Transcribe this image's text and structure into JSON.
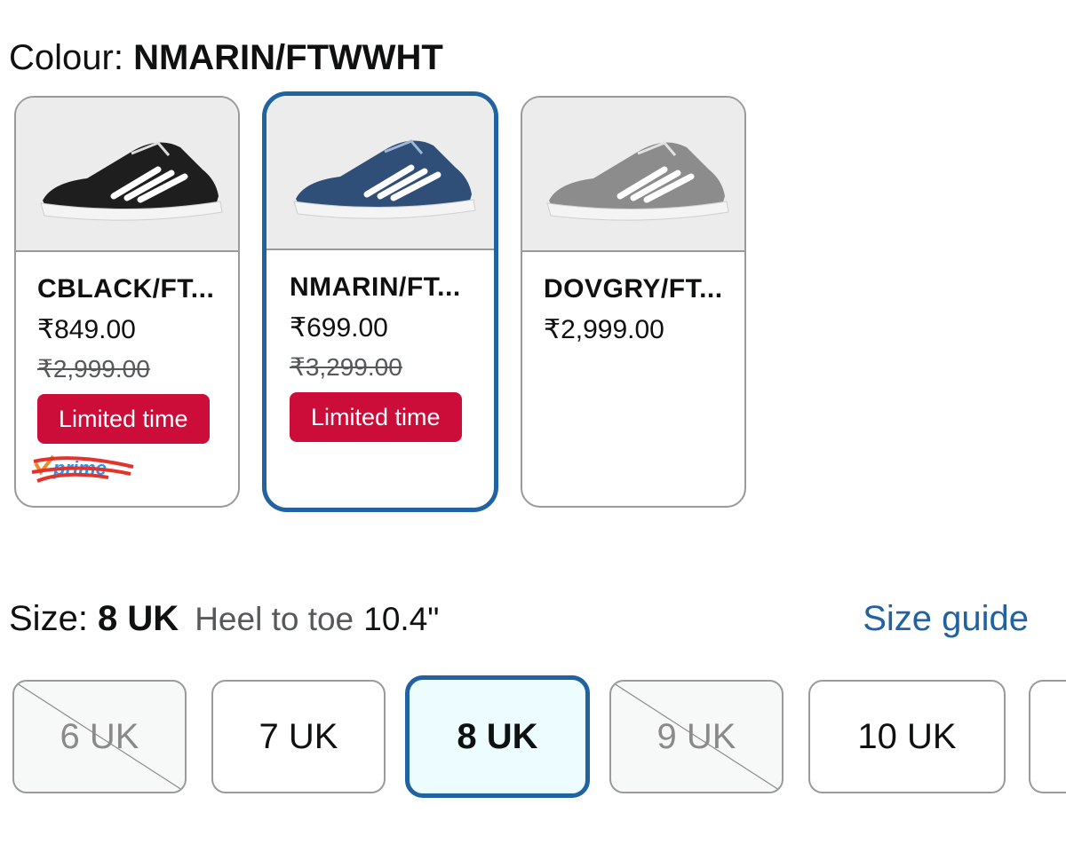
{
  "colour": {
    "label": "Colour: ",
    "selected": "NMARIN/FTWWHT"
  },
  "swatches": [
    {
      "name": "CBLACK/FT...",
      "price": "₹849.00",
      "mrp": "₹2,999.00",
      "badge": "Limited time",
      "prime": "prime",
      "shoe_color": "#1e1e1e",
      "selected": false
    },
    {
      "name": "NMARIN/FT...",
      "price": "₹699.00",
      "mrp": "₹3,299.00",
      "badge": "Limited time",
      "shoe_color": "#2f4f78",
      "selected": true
    },
    {
      "name": "DOVGRY/FT...",
      "price": "₹2,999.00",
      "shoe_color": "#8c8c8c",
      "selected": false
    }
  ],
  "size": {
    "label": "Size: ",
    "selected": "8 UK",
    "heel_label": "Heel to toe",
    "heel_value": "10.4\"",
    "guide_link": "Size guide"
  },
  "sizes": [
    {
      "label": "6 UK",
      "available": false
    },
    {
      "label": "7 UK",
      "available": true
    },
    {
      "label": "8 UK",
      "available": true,
      "selected": true
    },
    {
      "label": "9 UK",
      "available": false
    },
    {
      "label": "10 UK",
      "available": true
    }
  ],
  "colors": {
    "accent": "#2162a1",
    "deal_badge": "#cc0c39",
    "selected_size_bg": "#edfdff"
  }
}
